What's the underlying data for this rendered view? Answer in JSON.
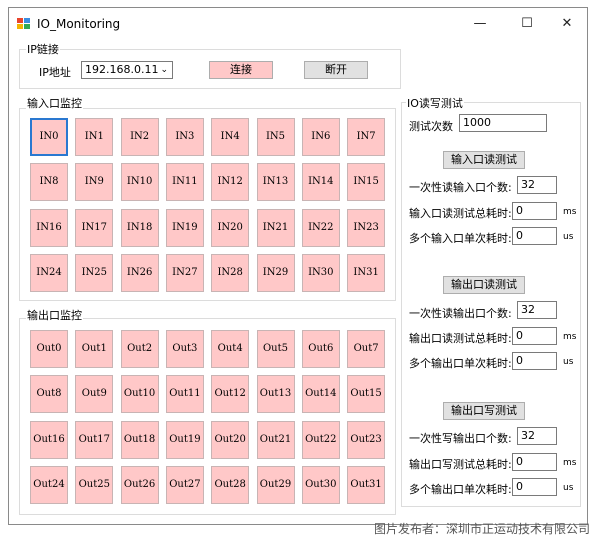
{
  "window": {
    "title": "IO_Monitoring",
    "minimize": "—",
    "maximize": "☐",
    "close": "✕"
  },
  "ip": {
    "group_title": "IP链接",
    "address_label": "IP地址",
    "address_value": "192.168.0.11",
    "connect": "连接",
    "disconnect": "断开"
  },
  "input": {
    "group_title": "输入口监控",
    "items": [
      "IN0",
      "IN1",
      "IN2",
      "IN3",
      "IN4",
      "IN5",
      "IN6",
      "IN7",
      "IN8",
      "IN9",
      "IN10",
      "IN11",
      "IN12",
      "IN13",
      "IN14",
      "IN15",
      "IN16",
      "IN17",
      "IN18",
      "IN19",
      "IN20",
      "IN21",
      "IN22",
      "IN23",
      "IN24",
      "IN25",
      "IN26",
      "IN27",
      "IN28",
      "IN29",
      "IN30",
      "IN31"
    ]
  },
  "output": {
    "group_title": "输出口监控",
    "items": [
      "Out0",
      "Out1",
      "Out2",
      "Out3",
      "Out4",
      "Out5",
      "Out6",
      "Out7",
      "Out8",
      "Out9",
      "Out10",
      "Out11",
      "Out12",
      "Out13",
      "Out14",
      "Out15",
      "Out16",
      "Out17",
      "Out18",
      "Out19",
      "Out20",
      "Out21",
      "Out22",
      "Out23",
      "Out24",
      "Out25",
      "Out26",
      "Out27",
      "Out28",
      "Out29",
      "Out30",
      "Out31"
    ]
  },
  "test": {
    "group_title": "IO读写测试",
    "count_label": "测试次数",
    "count_value": "1000",
    "input_read_button": "输入口读测试",
    "input_read_num_label": "一次性读输入口个数:",
    "input_read_num_value": "32",
    "input_read_total_label": "输入口读测试总耗时:",
    "input_read_total_value": "0",
    "input_read_total_unit": "ms",
    "input_read_single_label": "多个输入口单次耗时:",
    "input_read_single_value": "0",
    "input_read_single_unit": "us",
    "output_read_button": "输出口读测试",
    "output_read_num_label": "一次性读输出口个数:",
    "output_read_num_value": "32",
    "output_read_total_label": "输出口读测试总耗时:",
    "output_read_total_value": "0",
    "output_read_total_unit": "ms",
    "output_read_single_label": "多个输出口单次耗时:",
    "output_read_single_value": "0",
    "output_read_single_unit": "us",
    "output_write_button": "输出口写测试",
    "output_write_num_label": "一次性写输出口个数:",
    "output_write_num_value": "32",
    "output_write_total_label": "输出口写测试总耗时:",
    "output_write_total_value": "0",
    "output_write_total_unit": "ms",
    "output_write_single_label": "多个输出口单次耗时:",
    "output_write_single_value": "0",
    "output_write_single_unit": "us"
  },
  "watermark": "图片发布者：深圳市正运动技术有限公司",
  "colors": {
    "io_background": "#ffc8c8",
    "focus_border": "#2a78d0"
  }
}
